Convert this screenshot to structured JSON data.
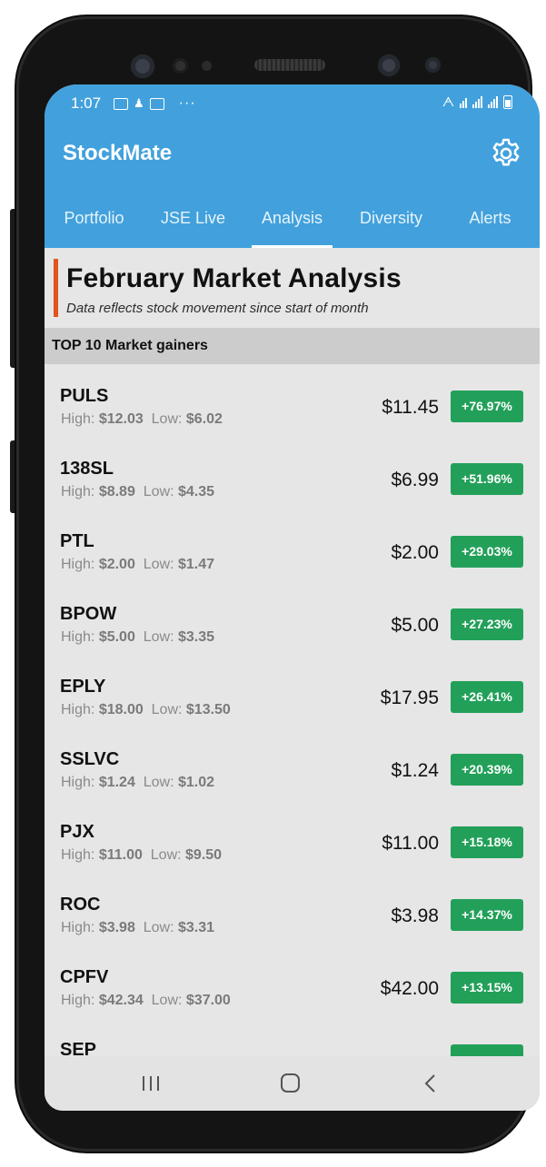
{
  "status_bar": {
    "time": "1:07",
    "dots": "···"
  },
  "app": {
    "title": "StockMate"
  },
  "tabs": [
    {
      "label": "Portfolio"
    },
    {
      "label": "JSE Live"
    },
    {
      "label": "Analysis"
    },
    {
      "label": "Diversity"
    },
    {
      "label": "Alerts"
    }
  ],
  "active_tab": "Analysis",
  "headline": {
    "title": "February Market Analysis",
    "subtitle": "Data reflects stock movement since start of month"
  },
  "section": {
    "title": "TOP 10 Market gainers"
  },
  "labels": {
    "high": "High:",
    "low": "Low:"
  },
  "gainers": [
    {
      "symbol": "PULS",
      "high": "$12.03",
      "low": "$6.02",
      "price": "$11.45",
      "change": "+76.97%"
    },
    {
      "symbol": "138SL",
      "high": "$8.89",
      "low": "$4.35",
      "price": "$6.99",
      "change": "+51.96%"
    },
    {
      "symbol": "PTL",
      "high": "$2.00",
      "low": "$1.47",
      "price": "$2.00",
      "change": "+29.03%"
    },
    {
      "symbol": "BPOW",
      "high": "$5.00",
      "low": "$3.35",
      "price": "$5.00",
      "change": "+27.23%"
    },
    {
      "symbol": "EPLY",
      "high": "$18.00",
      "low": "$13.50",
      "price": "$17.95",
      "change": "+26.41%"
    },
    {
      "symbol": "SSLVC",
      "high": "$1.24",
      "low": "$1.02",
      "price": "$1.24",
      "change": "+20.39%"
    },
    {
      "symbol": "PJX",
      "high": "$11.00",
      "low": "$9.50",
      "price": "$11.00",
      "change": "+15.18%"
    },
    {
      "symbol": "ROC",
      "high": "$3.98",
      "low": "$3.31",
      "price": "$3.98",
      "change": "+14.37%"
    },
    {
      "symbol": "CPFV",
      "high": "$42.34",
      "low": "$37.00",
      "price": "$42.00",
      "change": "+13.15%"
    },
    {
      "symbol": "SEP",
      "high": "",
      "low": "",
      "price": "",
      "change": ""
    }
  ],
  "colors": {
    "app_bar": "#42a1dc",
    "accent": "#e2541d",
    "gain": "#22a059",
    "section_header": "#cccccc"
  },
  "icons": {
    "settings": "gear-icon",
    "nav_recent": "recent-apps-icon",
    "nav_home": "home-icon",
    "nav_back": "back-icon"
  }
}
